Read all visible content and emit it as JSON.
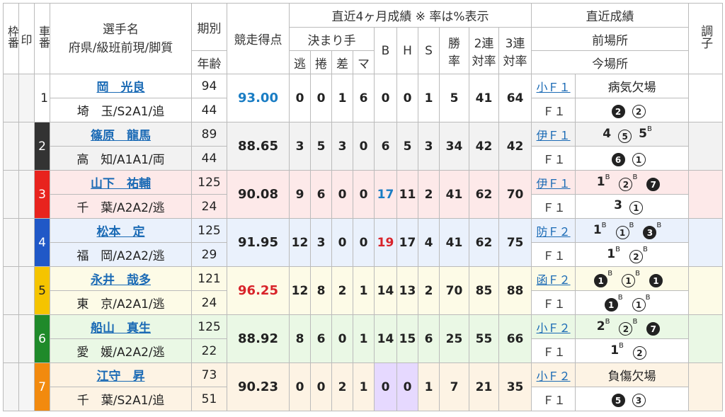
{
  "header": {
    "waku": "枠番",
    "in": "印",
    "sha": "車番",
    "name_top": "選手名",
    "name_bottom": "府県/級班前現/脚質",
    "kibetsu": "期別",
    "age": "年齢",
    "score": "競走得点",
    "recent_title": "直近4ヶ月成績 ※ 率は%表示",
    "kimarite": "決まり手",
    "k1": "逃",
    "k2": "捲",
    "k3": "差",
    "k4": "マ",
    "b": "B",
    "h": "H",
    "s": "S",
    "win_top": "勝",
    "win_bottom": "率",
    "r2_top": "2連",
    "r2_bottom": "対率",
    "r3_top": "3連",
    "r3_bottom": "対率",
    "latest_title": "直近成績",
    "prev_venue": "前場所",
    "cur_venue": "今場所",
    "cond": "調子"
  },
  "colors": {
    "waku1": "#ffffff",
    "waku2": "#333333",
    "waku3": "#e8231e",
    "waku4": "#2058c7",
    "waku5": "#f5c400",
    "waku6": "#1f8a2a",
    "waku7": "#f28a0e",
    "row2": "#f2f2f2",
    "row3": "#fde9e9",
    "row4": "#eaf1fc",
    "row5": "#fdfbe7",
    "row6": "#eaf8e5",
    "row7": "#fdf3e4"
  },
  "riders": [
    {
      "num": "1",
      "name": "岡　光良",
      "info": "埼　玉/S2A1/追",
      "kibetsu": "94",
      "age": "44",
      "score": "93.00",
      "score_color": "blue",
      "k1": "0",
      "k2": "0",
      "k3": "1",
      "k4": "6",
      "b": "0",
      "h": "0",
      "s": "1",
      "win": "5",
      "r2": "41",
      "r3": "64",
      "prev_venue": "小Ｆ１",
      "prev_note": "病気欠場",
      "cur_venue": "Ｆ１"
    },
    {
      "num": "2",
      "name": "篠原　龍馬",
      "info": "高　知/A1A1/両",
      "kibetsu": "89",
      "age": "44",
      "score": "88.65",
      "score_color": "",
      "k1": "3",
      "k2": "5",
      "k3": "3",
      "k4": "0",
      "b": "6",
      "h": "5",
      "s": "3",
      "win": "34",
      "r2": "42",
      "r3": "42",
      "prev_venue": "伊Ｆ１",
      "cur_venue": "Ｆ１"
    },
    {
      "num": "3",
      "name": "山下　祐輔",
      "info": "千　葉/A2A2/逃",
      "kibetsu": "125",
      "age": "24",
      "score": "90.08",
      "score_color": "",
      "k1": "9",
      "k2": "6",
      "k3": "0",
      "k4": "0",
      "b": "17",
      "h": "11",
      "s": "2",
      "win": "41",
      "r2": "62",
      "r3": "70",
      "prev_venue": "伊Ｆ１",
      "cur_venue": "Ｆ１"
    },
    {
      "num": "4",
      "name": "松本　定",
      "info": "福　岡/A2A2/逃",
      "kibetsu": "125",
      "age": "29",
      "score": "91.95",
      "score_color": "",
      "k1": "12",
      "k2": "3",
      "k3": "0",
      "k4": "0",
      "b": "19",
      "h": "17",
      "s": "4",
      "win": "41",
      "r2": "62",
      "r3": "75",
      "prev_venue": "防Ｆ２",
      "cur_venue": "Ｆ１"
    },
    {
      "num": "5",
      "name": "永井　哉多",
      "info": "東　京/A2A1/逃",
      "kibetsu": "121",
      "age": "24",
      "score": "96.25",
      "score_color": "red",
      "k1": "12",
      "k2": "8",
      "k3": "2",
      "k4": "1",
      "b": "14",
      "h": "13",
      "s": "2",
      "win": "70",
      "r2": "85",
      "r3": "88",
      "prev_venue": "函Ｆ２",
      "cur_venue": "Ｆ１"
    },
    {
      "num": "6",
      "name": "船山　真生",
      "info": "愛　媛/A2A2/逃",
      "kibetsu": "125",
      "age": "22",
      "score": "88.92",
      "score_color": "",
      "k1": "8",
      "k2": "6",
      "k3": "0",
      "k4": "1",
      "b": "14",
      "h": "15",
      "s": "6",
      "win": "25",
      "r2": "55",
      "r3": "66",
      "prev_venue": "小Ｆ２",
      "cur_venue": "Ｆ１"
    },
    {
      "num": "7",
      "name": "江守　昇",
      "info": "千　葉/S2A1/追",
      "kibetsu": "73",
      "age": "51",
      "score": "90.23",
      "score_color": "",
      "k1": "0",
      "k2": "0",
      "k3": "2",
      "k4": "1",
      "b": "0",
      "h": "0",
      "s": "1",
      "win": "7",
      "r2": "21",
      "r3": "35",
      "prev_venue": "小Ｆ２",
      "prev_note": "負傷欠場",
      "cur_venue": "Ｆ１"
    }
  ],
  "results": {
    "r2_prev": [
      "4",
      "5",
      "5",
      "B"
    ],
    "r2_cur": [
      "6",
      "1"
    ],
    "r3_prev": [
      "1",
      "B",
      "2",
      "B",
      "7"
    ],
    "r3_cur": [
      "3",
      "1"
    ],
    "r4_prev": [
      "1",
      "B",
      "1",
      "B",
      "3",
      "B"
    ],
    "r4_cur": [
      "1",
      "B",
      "2",
      "B"
    ],
    "r5_prev": [
      "1",
      "B",
      "1",
      "B",
      "1"
    ],
    "r5_cur": [
      "1",
      "B",
      "1",
      "B"
    ],
    "r6_prev": [
      "2",
      "B",
      "2",
      "B",
      "7"
    ],
    "r6_cur": [
      "1",
      "B",
      "2"
    ],
    "r1_cur": [
      "2",
      "2"
    ],
    "r7_cur": [
      "5",
      "3"
    ]
  }
}
